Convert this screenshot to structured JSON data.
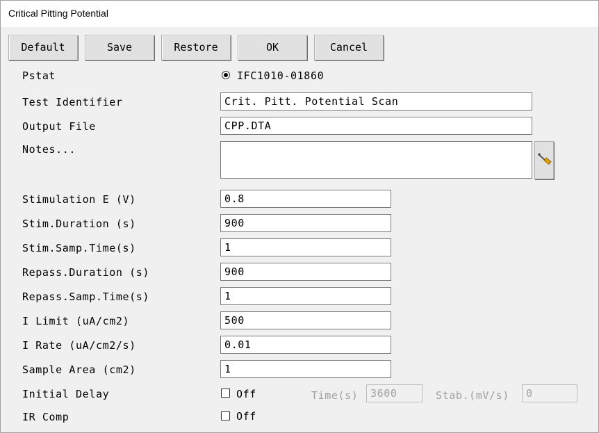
{
  "window": {
    "title": "Critical Pitting Potential"
  },
  "toolbar": {
    "default_label": "Default",
    "save_label": "Save",
    "restore_label": "Restore",
    "ok_label": "OK",
    "cancel_label": "Cancel"
  },
  "pstat": {
    "label": "Pstat",
    "value": "IFC1010-01860",
    "selected": true
  },
  "test_identifier": {
    "label": "Test Identifier",
    "value": "Crit. Pitt. Potential Scan"
  },
  "output_file": {
    "label": "Output File",
    "value": "CPP.DTA"
  },
  "notes": {
    "label": "Notes...",
    "value": "",
    "edit_icon": "screwdriver-icon"
  },
  "params": [
    {
      "label": "Stimulation E (V)",
      "value": "0.8"
    },
    {
      "label": "Stim.Duration (s)",
      "value": "900"
    },
    {
      "label": "Stim.Samp.Time(s)",
      "value": "1"
    },
    {
      "label": "Repass.Duration (s)",
      "value": "900"
    },
    {
      "label": "Repass.Samp.Time(s)",
      "value": "1"
    },
    {
      "label": "I Limit (uA/cm2)",
      "value": "500"
    },
    {
      "label": "I Rate (uA/cm2/s)",
      "value": "0.01"
    },
    {
      "label": "Sample Area (cm2)",
      "value": "1"
    }
  ],
  "initial_delay": {
    "label": "Initial Delay",
    "checkbox_label": "Off",
    "checked": false,
    "time_label": "Time(s)",
    "time_value": "3600",
    "stab_label": "Stab.(mV/s)",
    "stab_value": "0"
  },
  "ir_comp": {
    "label": "IR Comp",
    "checkbox_label": "Off",
    "checked": false
  }
}
